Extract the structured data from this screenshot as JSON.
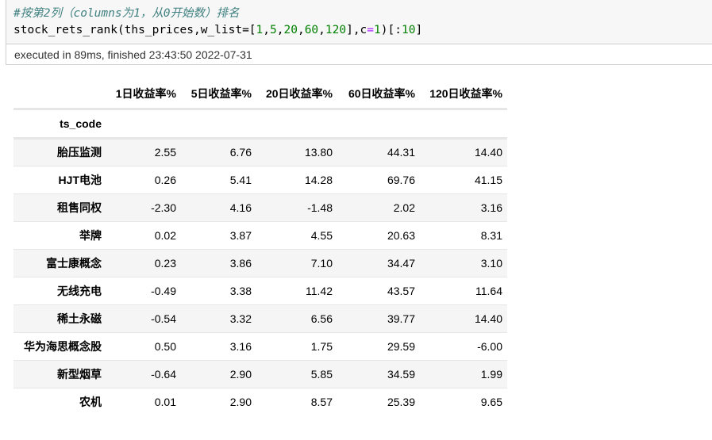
{
  "code_cell": {
    "comment": "#按第2列（columns为1，从0开始数）排名",
    "code_parts": {
      "p1": "stock_rets_rank(ths_prices,w_list=[",
      "n1": "1",
      "c1": ",",
      "n2": "5",
      "c2": ",",
      "n3": "20",
      "c3": ",",
      "n4": "60",
      "c4": ",",
      "n5": "120",
      "p2": "],c",
      "eq": "=",
      "n6": "1",
      "p3": ")[:",
      "n7": "10",
      "p4": "]"
    }
  },
  "execution": {
    "status": "executed in 89ms, finished 23:43:50 2022-07-31"
  },
  "table": {
    "columns": [
      "1日收益率%",
      "5日收益率%",
      "20日收益率%",
      "60日收益率%",
      "120日收益率%"
    ],
    "index_name": "ts_code",
    "rows": [
      {
        "name": "胎压监测",
        "values": [
          "2.55",
          "6.76",
          "13.80",
          "44.31",
          "14.40"
        ]
      },
      {
        "name": "HJT电池",
        "values": [
          "0.26",
          "5.41",
          "14.28",
          "69.76",
          "41.15"
        ]
      },
      {
        "name": "租售同权",
        "values": [
          "-2.30",
          "4.16",
          "-1.48",
          "2.02",
          "3.16"
        ]
      },
      {
        "name": "举牌",
        "values": [
          "0.02",
          "3.87",
          "4.55",
          "20.63",
          "8.31"
        ]
      },
      {
        "name": "富士康概念",
        "values": [
          "0.23",
          "3.86",
          "7.10",
          "34.47",
          "3.10"
        ]
      },
      {
        "name": "无线充电",
        "values": [
          "-0.49",
          "3.38",
          "11.42",
          "43.57",
          "11.64"
        ]
      },
      {
        "name": "稀土永磁",
        "values": [
          "-0.54",
          "3.32",
          "6.56",
          "39.77",
          "14.40"
        ]
      },
      {
        "name": "华为海思概念股",
        "values": [
          "0.50",
          "3.16",
          "1.75",
          "29.59",
          "-6.00"
        ]
      },
      {
        "name": "新型烟草",
        "values": [
          "-0.64",
          "2.90",
          "5.85",
          "34.59",
          "1.99"
        ]
      },
      {
        "name": "农机",
        "values": [
          "0.01",
          "2.90",
          "8.57",
          "25.39",
          "9.65"
        ]
      }
    ]
  },
  "colors": {
    "comment": "#408080",
    "number": "#008000",
    "operator": "#aa22ff",
    "cell_background": "#f7f7f7",
    "row_stripe": "#f5f5f5"
  }
}
